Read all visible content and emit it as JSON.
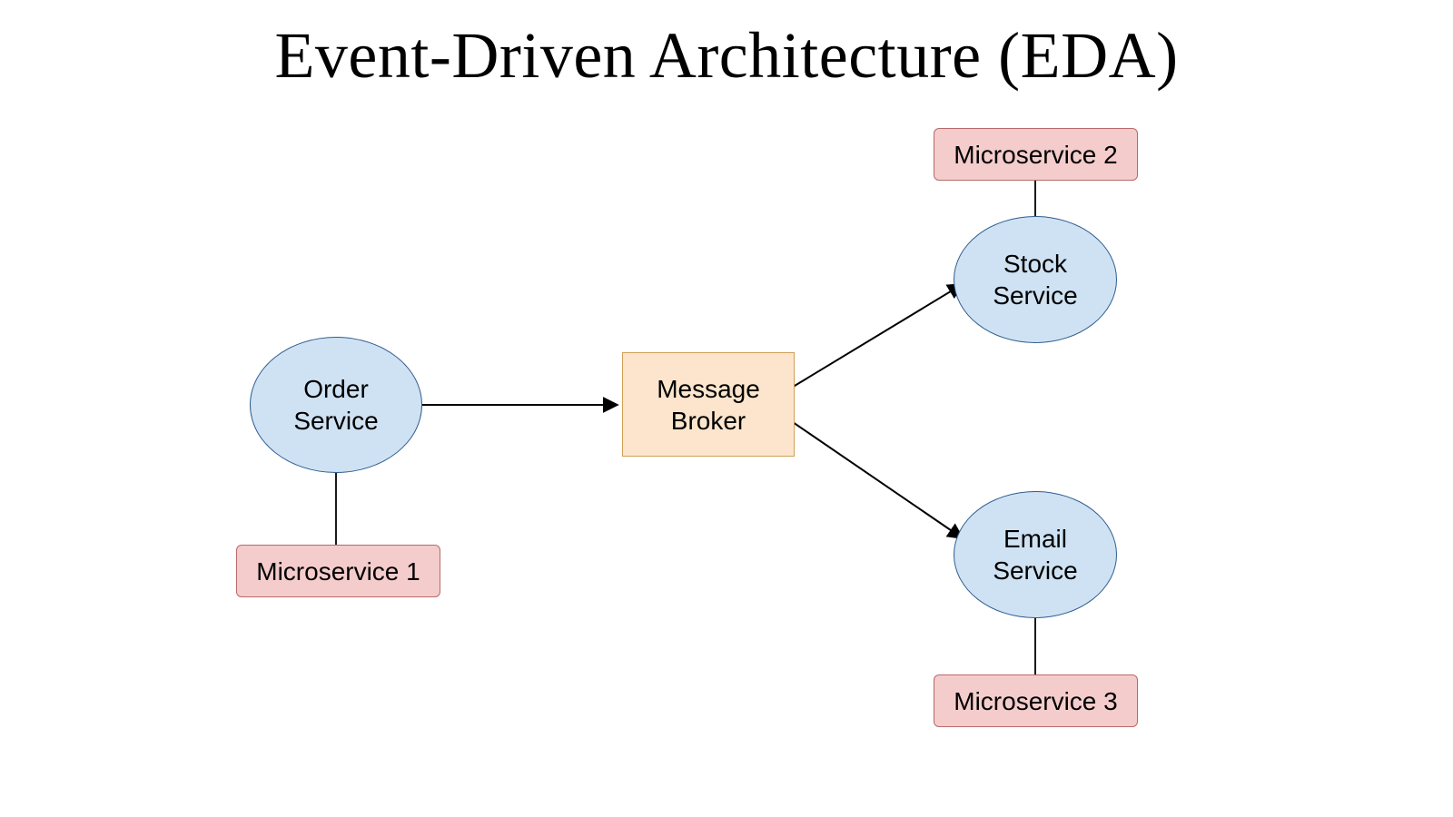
{
  "title": "Event-Driven Architecture (EDA)",
  "nodes": {
    "order": {
      "label": "Order\nService"
    },
    "broker": {
      "label": "Message\nBroker"
    },
    "stock": {
      "label": "Stock\nService"
    },
    "email": {
      "label": "Email\nService"
    },
    "ms1": {
      "label": "Microservice 1"
    },
    "ms2": {
      "label": "Microservice 2"
    },
    "ms3": {
      "label": "Microservice 3"
    }
  }
}
